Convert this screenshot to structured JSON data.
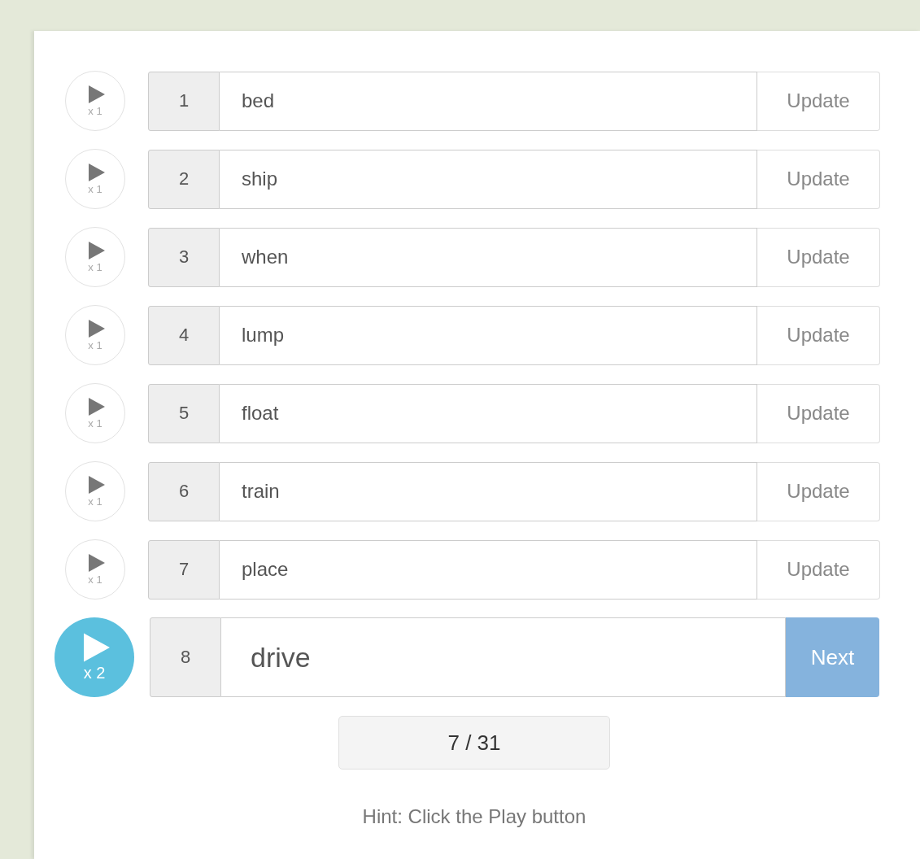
{
  "rows": [
    {
      "kind": "done",
      "plays": "x 1",
      "number": "1",
      "word": "bed",
      "button": "Update"
    },
    {
      "kind": "done",
      "plays": "x 1",
      "number": "2",
      "word": "ship",
      "button": "Update"
    },
    {
      "kind": "done",
      "plays": "x 1",
      "number": "3",
      "word": "when",
      "button": "Update"
    },
    {
      "kind": "done",
      "plays": "x 1",
      "number": "4",
      "word": "lump",
      "button": "Update"
    },
    {
      "kind": "done",
      "plays": "x 1",
      "number": "5",
      "word": "float",
      "button": "Update"
    },
    {
      "kind": "done",
      "plays": "x 1",
      "number": "6",
      "word": "train",
      "button": "Update"
    },
    {
      "kind": "done",
      "plays": "x 1",
      "number": "7",
      "word": "place",
      "button": "Update"
    },
    {
      "kind": "current",
      "plays": "x 2",
      "number": "8",
      "word": "drive",
      "button": "Next"
    }
  ],
  "progress": "7 / 31",
  "hint": "Hint: Click the Play button"
}
